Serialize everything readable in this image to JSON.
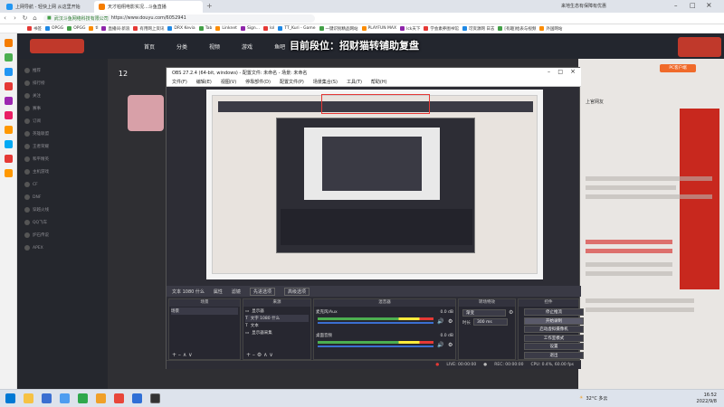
{
  "browser": {
    "tabs": [
      {
        "label": "上网导航 - 轻快上网 从这里开始",
        "color": "#2196f3"
      },
      {
        "label": "天才柏栩电影实况...斗鱼直播",
        "color": "#f57c00",
        "active": true
      }
    ],
    "url_company": "武汉斗鱼网络科技有限公司",
    "url": "https://www.douyu.com/6052941",
    "bookmarks": [
      "书签",
      "OPGG",
      "OPGG",
      "tl",
      "直播间·新浪",
      "有用网上资讯",
      "DRX Kevia",
      "Tab",
      "Linknet",
      "Sign...",
      "lol",
      "TT_Kuri - Game",
      "一键识别精品网站",
      "PLAYFUN MAX",
      "lck天下",
      "学会素养图书馆",
      "可资源网 日志",
      "[有趣]给表与视频",
      "外国网站"
    ],
    "right_note": "来地生态有保障有优惠"
  },
  "overlay_caption": "目前段位：招财猫转铺助复盘",
  "douyu": {
    "nav": [
      "首页",
      "分类",
      "视频",
      "游戏",
      "鱼吧"
    ],
    "sidebar": [
      "推荐",
      "排行榜",
      "关注",
      "赛事",
      "订阅",
      "英雄联盟",
      "王者荣耀",
      "和平精英",
      "主机游戏",
      "CF",
      "DNF",
      "穿越火线",
      "QQ飞车",
      "炉石传说",
      "APEX"
    ],
    "fans_count": "12",
    "chat_user": "上官网友",
    "right_badge": "PC客户端"
  },
  "obs": {
    "title": "OBS 27.2.4 (64-bit, windows) - 配置文件: 未命名 - 场景: 未命名",
    "menu": [
      "文件(F)",
      "编辑(E)",
      "视图(V)",
      "停靠部件(D)",
      "配置文件(P)",
      "场景集合(S)",
      "工具(T)",
      "帮助(H)"
    ],
    "ctrl_row": [
      "文本 1080 什么",
      "属性",
      "滤镜",
      "先进选项",
      "高级选项"
    ],
    "docks": {
      "scenes": {
        "title": "场景",
        "items": [
          "场景"
        ]
      },
      "sources": {
        "title": "来源",
        "items": [
          "显示器",
          "文字 1080 什么",
          "文本",
          "显示器采集"
        ]
      },
      "mixer": {
        "title": "混音器",
        "channels": [
          {
            "name": "麦克风/Aux",
            "db": "0.0 dB"
          },
          {
            "name": "桌面音频",
            "db": "0.0 dB"
          }
        ]
      },
      "transitions": {
        "title": "转场特效",
        "type": "渐变",
        "duration_label": "时长",
        "duration": "300 ms"
      },
      "controls": {
        "title": "控件",
        "buttons": [
          "停止推流",
          "开始录制",
          "启动虚拟摄像机",
          "工作室模式",
          "设置",
          "退出"
        ]
      }
    },
    "status": {
      "live": "LIVE: 00:00:00",
      "rec": "REC: 00:00:00",
      "cpu": "CPU: 0.4%, 60.00 fps"
    }
  },
  "taskbar": {
    "weather": "32°C 多云",
    "time": "16:52",
    "date": "2022/9/8"
  }
}
